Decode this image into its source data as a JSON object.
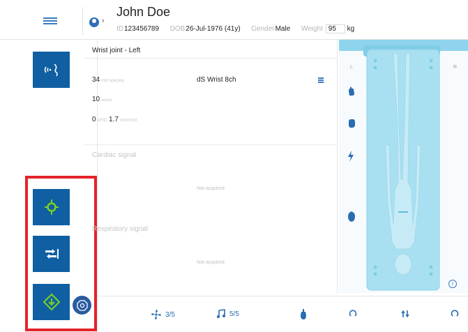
{
  "header": {
    "patient_name": "John Doe",
    "id_label": "ID",
    "id_value": "123456789",
    "dob_label": "DOB",
    "dob_value": "26-Jul-1976 (41y)",
    "gender_label": "Gender",
    "gender_value": "Male",
    "weight_label": "Weight",
    "weight_value": "95",
    "weight_unit": "kg"
  },
  "panel": {
    "title": "Wrist joint - Left",
    "value1": "34",
    "unit1": "mm spacing",
    "value2": "10",
    "unit2": "scans",
    "value3": "0",
    "unit3": "AFID",
    "value4": "1.7",
    "unit4": "mm/mSd",
    "coil_name": "dS Wrist 8ch",
    "cardiac_title": "Cardiac signal",
    "cardiac_status": "Not acquired",
    "resp_title": "Respiratory signal",
    "resp_status": "Not acquired"
  },
  "bottom": {
    "fan_value": "3/5",
    "music_value": "5/5"
  },
  "body": {
    "left_label": "L",
    "right_label": "R"
  },
  "colors": {
    "tile_blue": "#0f5fa2",
    "accent_green": "#7dd321",
    "highlight_red": "#e4232a",
    "table_cyan": "#a9e0f1"
  }
}
